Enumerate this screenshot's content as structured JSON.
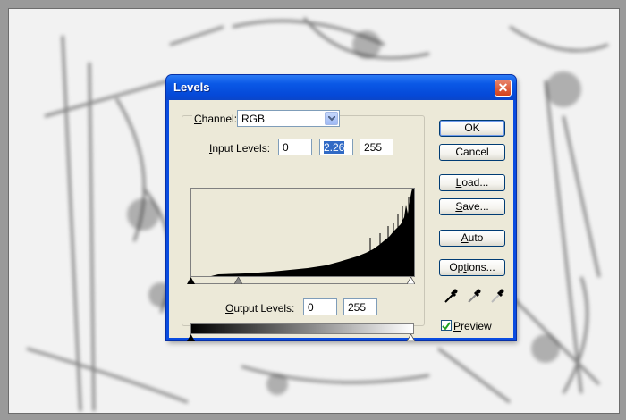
{
  "dialog": {
    "title": "Levels",
    "close_glyph": "✕",
    "channel": {
      "label_key": "C",
      "label_rest": "hannel:",
      "value": "RGB"
    },
    "input_levels": {
      "label_key": "I",
      "label_rest": "nput Levels:",
      "black": "0",
      "gamma": "2.26",
      "white": "255"
    },
    "output_levels": {
      "label_key": "O",
      "label_rest": "utput Levels:",
      "black": "0",
      "white": "255"
    },
    "buttons": {
      "ok": "OK",
      "cancel": "Cancel",
      "load_key": "L",
      "load_rest": "oad...",
      "save_key": "S",
      "save_rest": "ave...",
      "auto_key": "A",
      "auto_rest": "uto",
      "options_key": "t",
      "options_pre": "Op",
      "options_rest": "ions..."
    },
    "preview": {
      "label_key": "P",
      "label_rest": "review",
      "checked": true
    },
    "icons": [
      "chevron-down-icon",
      "black-eyedropper-icon",
      "gray-eyedropper-icon",
      "white-eyedropper-icon",
      "check-icon",
      "close-icon"
    ]
  }
}
